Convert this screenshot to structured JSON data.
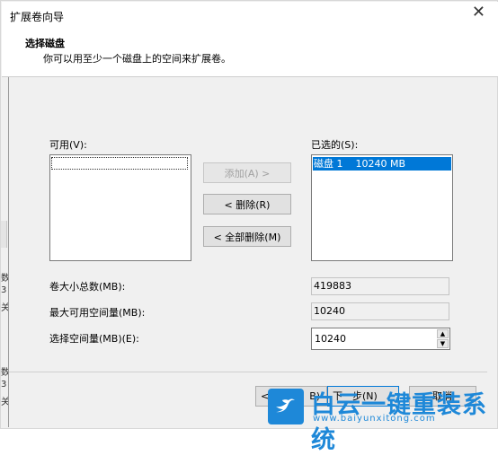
{
  "window": {
    "title": "扩展卷向导",
    "close_glyph": "✕"
  },
  "header": {
    "title": "选择磁盘",
    "subtitle": "你可以用至少一个磁盘上的空间来扩展卷。"
  },
  "available": {
    "label": "可用(V):"
  },
  "selected": {
    "label": "已选的(S):",
    "items": [
      {
        "disk": "磁盘 1",
        "size": "10240 MB"
      }
    ]
  },
  "buttons": {
    "add": "添加(A) >",
    "remove": "< 删除(R)",
    "remove_all": "< 全部删除(M)"
  },
  "fields": {
    "total_size_label": "卷大小总数(MB):",
    "total_size_value": "419883",
    "max_available_label": "最大可用空间量(MB):",
    "max_available_value": "10240",
    "select_amount_label": "选择空间量(MB)(E):",
    "select_amount_value": "10240"
  },
  "nav": {
    "back": "<",
    "back_suffix": "B)",
    "next": "下一步(N)",
    "cancel": "取消"
  },
  "background_fragments": [
    "数",
    "3",
    "关",
    "数",
    "3",
    "关"
  ],
  "watermark": {
    "brand": "白云一键重装系统",
    "url": "www.baiyunxitong.com"
  },
  "colors": {
    "selection": "#0078d7",
    "watermark": "#1e88d8"
  }
}
